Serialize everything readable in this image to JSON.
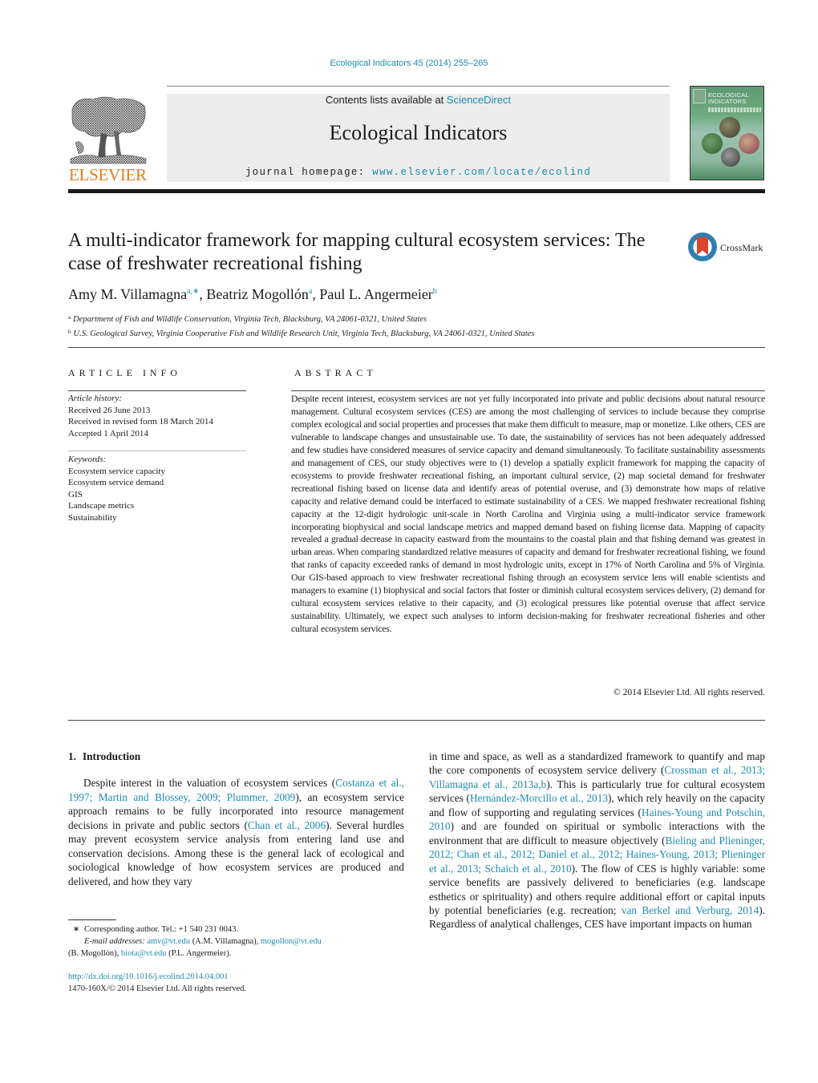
{
  "header": {
    "journal_reference": "Ecological Indicators 45 (2014) 255–265",
    "contents_prefix": "Contents lists available at ",
    "contents_link": "ScienceDirect",
    "journal_title": "Ecological Indicators",
    "homepage_prefix": "journal homepage: ",
    "homepage_link": "www.elsevier.com/locate/ecolind",
    "publisher_logo_text": "ELSEVIER",
    "cover_title_line1": "ECOLOGICAL",
    "cover_title_line2": "INDICATORS",
    "crossmark_label": "CrossMark"
  },
  "colors": {
    "link": "#1d8bb0",
    "elsevier_orange": "#e87b1e",
    "masthead_bg": "#ececec",
    "crossmark_red": "#d9452d",
    "crossmark_blue": "#2f7fb0"
  },
  "article": {
    "title": "A multi-indicator framework for mapping cultural ecosystem services: The case of freshwater recreational fishing",
    "authors": [
      {
        "name": "Amy M. Villamagna",
        "sup": "a,∗",
        "sep": ", "
      },
      {
        "name": "Beatriz Mogollón",
        "sup": "a",
        "sep": ", "
      },
      {
        "name": "Paul L. Angermeier",
        "sup": "b",
        "sep": ""
      }
    ],
    "affiliations": [
      {
        "key": "a",
        "text": "Department of Fish and Wildlife Conservation, Virginia Tech, Blacksburg, VA 24061-0321, United States"
      },
      {
        "key": "b",
        "text": "U.S. Geological Survey, Virginia Cooperative Fish and Wildlife Research Unit, Virginia Tech, Blacksburg, VA 24061-0321, United States"
      }
    ]
  },
  "article_info": {
    "heading": "ARTICLE INFO",
    "history_label": "Article history:",
    "history": [
      "Received 26 June 2013",
      "Received in revised form 18 March 2014",
      "Accepted 1 April 2014"
    ],
    "keywords_label": "Keywords:",
    "keywords": [
      "Ecosystem service capacity",
      "Ecosystem service demand",
      "GIS",
      "Landscape metrics",
      "Sustainability"
    ]
  },
  "abstract": {
    "heading": "ABSTRACT",
    "text": "Despite recent interest, ecosystem services are not yet fully incorporated into private and public decisions about natural resource management. Cultural ecosystem services (CES) are among the most challenging of services to include because they comprise complex ecological and social properties and processes that make them difficult to measure, map or monetize. Like others, CES are vulnerable to landscape changes and unsustainable use. To date, the sustainability of services has not been adequately addressed and few studies have considered measures of service capacity and demand simultaneously. To facilitate sustainability assessments and management of CES, our study objectives were to (1) develop a spatially explicit framework for mapping the capacity of ecosystems to provide freshwater recreational fishing, an important cultural service, (2) map societal demand for freshwater recreational fishing based on license data and identify areas of potential overuse, and (3) demonstrate how maps of relative capacity and relative demand could be interfaced to estimate sustainability of a CES. We mapped freshwater recreational fishing capacity at the 12-digit hydrologic unit-scale in North Carolina and Virginia using a multi-indicator service framework incorporating biophysical and social landscape metrics and mapped demand based on fishing license data. Mapping of capacity revealed a gradual decrease in capacity eastward from the mountains to the coastal plain and that fishing demand was greatest in urban areas. When comparing standardized relative measures of capacity and demand for freshwater recreational fishing, we found that ranks of capacity exceeded ranks of demand in most hydrologic units, except in 17% of North Carolina and 5% of Virginia. Our GIS-based approach to view freshwater recreational fishing through an ecosystem service lens will enable scientists and managers to examine (1) biophysical and social factors that foster or diminish cultural ecosystem services delivery, (2) demand for cultural ecosystem services relative to their capacity, and (3) ecological pressures like potential overuse that affect service sustainability. Ultimately, we expect such analyses to inform decision-making for freshwater recreational fisheries and other cultural ecosystem services.",
    "copyright": "© 2014 Elsevier Ltd. All rights reserved."
  },
  "body": {
    "section_number": "1.",
    "section_title": "Introduction",
    "left": [
      {
        "t": "Despite interest in the valuation of ecosystem services ("
      },
      {
        "t": "Costanza et al., 1997; Martin and Blossey, 2009; Plummer, 2009",
        "link": true
      },
      {
        "t": "), an ecosystem service approach remains to be fully incorporated into resource management decisions in private and public sectors ("
      },
      {
        "t": "Chan et al., 2006",
        "link": true
      },
      {
        "t": "). Several hurdles may prevent ecosystem service analysis from entering land use and conservation decisions. Among these is the general lack of ecological and sociological knowledge of how ecosystem services are produced and delivered, and how they vary"
      }
    ],
    "right": [
      {
        "t": "in time and space, as well as a standardized framework to quantify and map the core components of ecosystem service delivery ("
      },
      {
        "t": "Crossman et al., 2013; Villamagna et al., 2013a,b",
        "link": true
      },
      {
        "t": "). This is particularly true for cultural ecosystem services ("
      },
      {
        "t": "Hernández-Morcillo et al., 2013",
        "link": true
      },
      {
        "t": "), which rely heavily on the capacity and flow of supporting and regulating services ("
      },
      {
        "t": "Haines-Young and Potschin, 2010",
        "link": true
      },
      {
        "t": ") and are founded on spiritual or symbolic interactions with the environment that are difficult to measure objectively ("
      },
      {
        "t": "Bieling and Plieninger, 2012; Chan et al., 2012; Daniel et al., 2012; Haines-Young, 2013; Plieninger et al., 2013; Schaich et al., 2010",
        "link": true
      },
      {
        "t": "). The flow of CES is highly variable: some service benefits are passively delivered to beneficiaries (e.g. landscape esthetics or spirituality) and others require additional effort or capital inputs by potential beneficiaries (e.g. recreation; "
      },
      {
        "t": "van Berkel and Verburg, 2014",
        "link": true
      },
      {
        "t": "). Regardless of analytical challenges, CES have important impacts on human"
      }
    ]
  },
  "footnotes": {
    "star": "∗",
    "corresponding": "Corresponding author. Tel.: +1 540 231 0043.",
    "email_label": "E-mail addresses:",
    "emails": [
      {
        "addr": "amv@vt.edu",
        "who": " (A.M. Villamagna), "
      },
      {
        "addr": "mogollon@vt.edu",
        "who": ""
      },
      {
        "pre": "(B. Mogollón), ",
        "addr": "biota@vt.edu",
        "who": " (P.L. Angermeier)."
      }
    ],
    "doi": "http://dx.doi.org/10.1016/j.ecolind.2014.04.001",
    "issn_line": "1470-160X/© 2014 Elsevier Ltd. All rights reserved."
  }
}
